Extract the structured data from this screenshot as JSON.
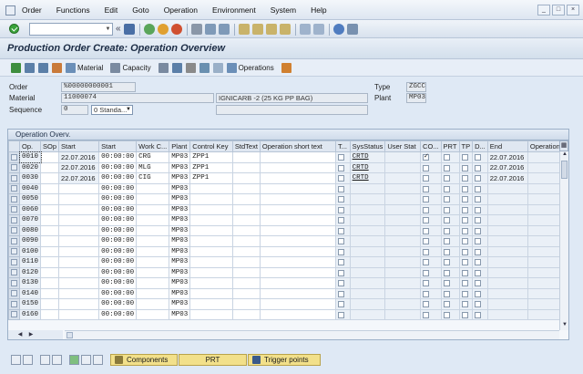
{
  "menu": {
    "items": [
      "Order",
      "Functions",
      "Edit",
      "Goto",
      "Operation",
      "Environment",
      "System",
      "Help"
    ]
  },
  "systoolbar": {
    "command_value": ""
  },
  "title": "Production Order Create: Operation Overview",
  "toolbar": {
    "material_label": "Material",
    "capacity_label": "Capacity",
    "operations_label": "Operations"
  },
  "header": {
    "order_label": "Order",
    "order_value": "%00000000001",
    "type_label": "Type",
    "type_value": "ZGCC",
    "material_label": "Material",
    "material_value": "11000074",
    "material_desc": "IGNICARB -2 (25 KG PP BAG)",
    "plant_label": "Plant",
    "plant_value": "MP03",
    "sequence_label": "Sequence",
    "sequence_value": "0",
    "sequence_type": "0 Standa..."
  },
  "table": {
    "caption": "Operation Overv.",
    "columns": [
      "Op.",
      "SOp",
      "Start",
      "Start",
      "Work C...",
      "Plant",
      "Control Key",
      "StdText",
      "Operation short text",
      "T...",
      "SysStatus",
      "User Stat",
      "CO...",
      "PRT",
      "TP",
      "D...",
      "End",
      "Operation ("
    ],
    "rows": [
      {
        "op": "0010",
        "start_date": "22.07.2016",
        "start_time": "00:00:00",
        "wc": "CRG",
        "plant": "MP03",
        "ck": "ZPP1",
        "sys": "CRTD",
        "co": true,
        "end": "22.07.2016"
      },
      {
        "op": "0020",
        "start_date": "22.07.2016",
        "start_time": "00:00:00",
        "wc": "MLG",
        "plant": "MP03",
        "ck": "ZPP1",
        "sys": "CRTD",
        "co": false,
        "end": "22.07.2016"
      },
      {
        "op": "0030",
        "start_date": "22.07.2016",
        "start_time": "00:00:00",
        "wc": "CIG",
        "plant": "MP03",
        "ck": "ZPP1",
        "sys": "CRTD",
        "co": false,
        "end": "22.07.2016"
      },
      {
        "op": "0040",
        "start_time": "00:00:00",
        "plant": "MP03"
      },
      {
        "op": "0050",
        "start_time": "00:00:00",
        "plant": "MP03"
      },
      {
        "op": "0060",
        "start_time": "00:00:00",
        "plant": "MP03"
      },
      {
        "op": "0070",
        "start_time": "00:00:00",
        "plant": "MP03"
      },
      {
        "op": "0080",
        "start_time": "00:00:00",
        "plant": "MP03"
      },
      {
        "op": "0090",
        "start_time": "00:00:00",
        "plant": "MP03"
      },
      {
        "op": "0100",
        "start_time": "00:00:00",
        "plant": "MP03"
      },
      {
        "op": "0110",
        "start_time": "00:00:00",
        "plant": "MP03"
      },
      {
        "op": "0120",
        "start_time": "00:00:00",
        "plant": "MP03"
      },
      {
        "op": "0130",
        "start_time": "00:00:00",
        "plant": "MP03"
      },
      {
        "op": "0140",
        "start_time": "00:00:00",
        "plant": "MP03"
      },
      {
        "op": "0150",
        "start_time": "00:00:00",
        "plant": "MP03"
      },
      {
        "op": "0160",
        "start_time": "00:00:00",
        "plant": "MP03"
      }
    ]
  },
  "bottom": {
    "components_label": "Components",
    "prt_label": "PRT",
    "trigger_label": "Trigger points"
  },
  "colors": {
    "accent_yellow": "#f2e08a",
    "enter_green": "#3aa33a"
  }
}
